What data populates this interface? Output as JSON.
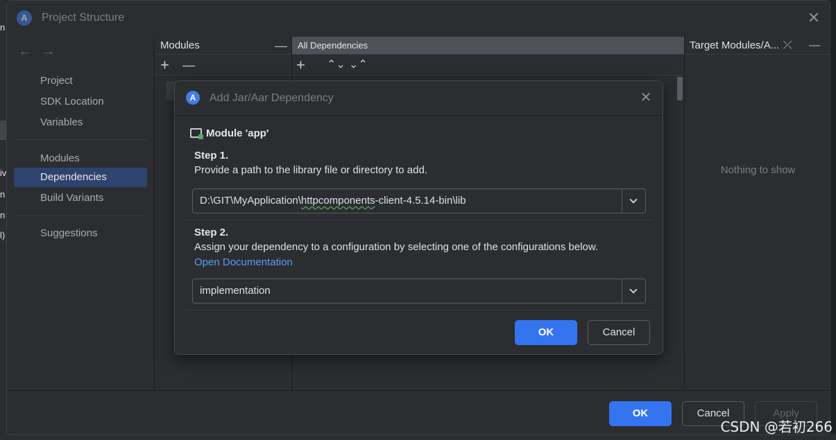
{
  "window": {
    "title": "Project Structure",
    "close_glyph": "✕"
  },
  "background": {
    "fragments": [
      "n",
      "iv",
      "n",
      "n",
      "l)"
    ]
  },
  "nav": {
    "back_arrow": "←",
    "forward_arrow": "→",
    "items": [
      {
        "label": "Project"
      },
      {
        "label": "SDK Location"
      },
      {
        "label": "Variables"
      },
      {
        "label": "Modules"
      },
      {
        "label": "Dependencies",
        "active": true
      },
      {
        "label": "Build Variants"
      },
      {
        "label": "Suggestions"
      }
    ]
  },
  "modules_col": {
    "header": "Modules",
    "minimize_glyph": "—",
    "add_glyph": "+",
    "remove_glyph": "—"
  },
  "deps_col": {
    "header": "All Dependencies",
    "add_glyph": "+",
    "expand_glyph": "⌃⌄",
    "collapse_glyph": "⌄⌃"
  },
  "target_col": {
    "header": "Target Modules/A...",
    "icons": "⤫ —",
    "empty_text": "Nothing to show"
  },
  "footer": {
    "ok_label": "OK",
    "cancel_label": "Cancel",
    "apply_label": "Apply"
  },
  "dialog": {
    "title": "Add Jar/Aar Dependency",
    "close_glyph": "✕",
    "module_label": "Module 'app'",
    "step1_heading": "Step 1.",
    "step1_text": "Provide a path to the library file or directory to add.",
    "path_prefix": "D:\\GIT\\MyApplication\\",
    "path_squiggle": "httpcomponents",
    "path_suffix": "-client-4.5.14-bin\\lib",
    "step2_heading": "Step 2.",
    "step2_text": "Assign your dependency to a configuration by selecting one of the configurations below.",
    "doc_link": "Open Documentation",
    "configuration_value": "implementation",
    "ok_label": "OK",
    "cancel_label": "Cancel"
  },
  "watermark": "CSDN @若初266",
  "colors": {
    "accent": "#3574f0",
    "link": "#589df6",
    "nav_active": "#2e436e",
    "background": "#2b2d30"
  }
}
